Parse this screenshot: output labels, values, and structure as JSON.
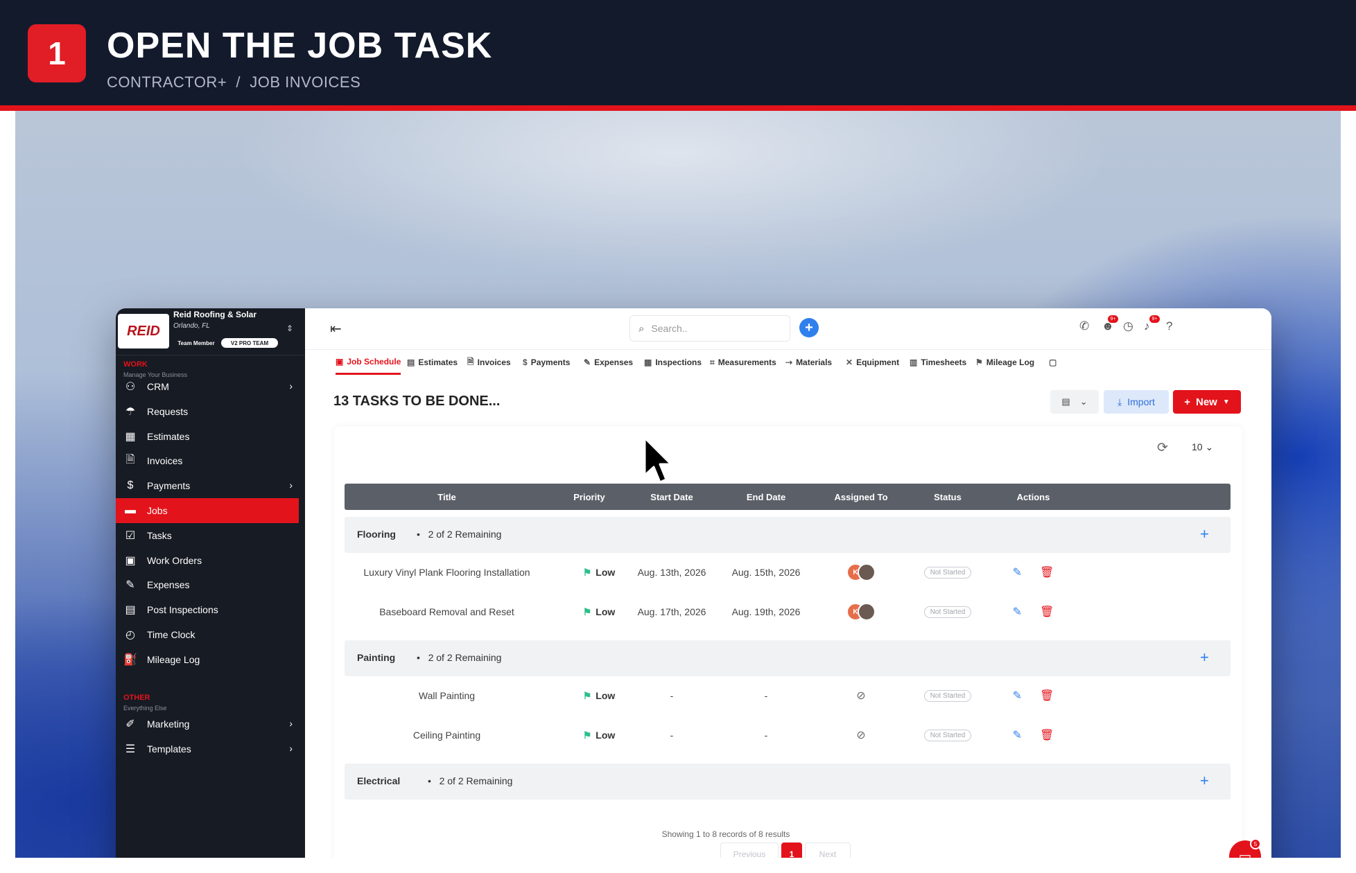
{
  "banner": {
    "step": "1",
    "title": "OPEN THE JOB TASK",
    "breadcrumb": "CONTRACTOR+  /  JOB INVOICES"
  },
  "company": {
    "logo_text": "REID",
    "name": "Reid Roofing & Solar",
    "location": "Orlando, FL",
    "role": "Team Member",
    "team": "V2 PRO TEAM"
  },
  "sidebar": {
    "work_title": "WORK",
    "work_sub": "Manage Your Business",
    "items": [
      {
        "label": "CRM",
        "icon": "crm-icon",
        "chevron": true
      },
      {
        "label": "Requests",
        "icon": "requests-icon",
        "chevron": false
      },
      {
        "label": "Estimates",
        "icon": "estimates-icon",
        "chevron": false
      },
      {
        "label": "Invoices",
        "icon": "invoices-icon",
        "chevron": false
      },
      {
        "label": "Payments",
        "icon": "payments-icon",
        "chevron": true
      },
      {
        "label": "Jobs",
        "icon": "jobs-icon",
        "chevron": false,
        "active": true
      },
      {
        "label": "Tasks",
        "icon": "tasks-icon",
        "chevron": false
      },
      {
        "label": "Work Orders",
        "icon": "work-orders-icon",
        "chevron": false
      },
      {
        "label": "Expenses",
        "icon": "expenses-icon",
        "chevron": false
      },
      {
        "label": "Post Inspections",
        "icon": "post-inspections-icon",
        "chevron": false
      },
      {
        "label": "Time Clock",
        "icon": "clock-icon",
        "chevron": false
      },
      {
        "label": "Mileage Log",
        "icon": "mileage-icon",
        "chevron": false
      }
    ],
    "other_title": "OTHER",
    "other_sub": "Everything Else",
    "other_items": [
      {
        "label": "Marketing",
        "icon": "marketing-icon",
        "chevron": true
      },
      {
        "label": "Templates",
        "icon": "templates-icon",
        "chevron": true
      }
    ]
  },
  "topbar": {
    "search_placeholder": "Search..",
    "badge_1": "9+",
    "badge_2": "9+"
  },
  "tabs": [
    {
      "label": "Job Schedule",
      "active": true
    },
    {
      "label": "Estimates"
    },
    {
      "label": "Invoices"
    },
    {
      "label": "Payments"
    },
    {
      "label": "Expenses"
    },
    {
      "label": "Inspections"
    },
    {
      "label": "Measurements"
    },
    {
      "label": "Materials"
    },
    {
      "label": "Equipment"
    },
    {
      "label": "Timesheets"
    },
    {
      "label": "Mileage Log"
    }
  ],
  "page": {
    "heading": "13 TASKS TO BE DONE...",
    "import_label": "Import",
    "new_label": "New",
    "per_page": "10"
  },
  "table": {
    "columns": [
      "Title",
      "Priority",
      "Start Date",
      "End Date",
      "Assigned To",
      "Status",
      "Actions"
    ],
    "groups": [
      {
        "name": "Flooring",
        "remaining": "2 of 2 Remaining",
        "tasks": [
          {
            "title": "Luxury Vinyl Plank Flooring Installation",
            "priority": "Low",
            "start": "Aug. 13th, 2026",
            "end": "Aug. 15th, 2026",
            "assigned": true,
            "status": "Not Started"
          },
          {
            "title": "Baseboard Removal and Reset",
            "priority": "Low",
            "start": "Aug. 17th, 2026",
            "end": "Aug. 19th, 2026",
            "assigned": true,
            "status": "Not Started"
          }
        ]
      },
      {
        "name": "Painting",
        "remaining": "2 of 2 Remaining",
        "tasks": [
          {
            "title": "Wall Painting",
            "priority": "Low",
            "start": "-",
            "end": "-",
            "assigned": false,
            "status": "Not Started"
          },
          {
            "title": "Ceiling Painting",
            "priority": "Low",
            "start": "-",
            "end": "-",
            "assigned": false,
            "status": "Not Started"
          }
        ]
      },
      {
        "name": "Electrical",
        "remaining": "2 of 2 Remaining",
        "tasks": []
      }
    ],
    "avatar_initial": "K",
    "showing": "Showing 1 to 8 records of 8 results",
    "prev_label": "Previous",
    "current_page": "1",
    "next_label": "Next"
  },
  "chat": {
    "count": "5"
  },
  "colors": {
    "brand_red": "#e3131b",
    "sidebar_bg": "#171b23",
    "accent_blue": "#2f80ed",
    "banner_bg": "#131a2c"
  }
}
